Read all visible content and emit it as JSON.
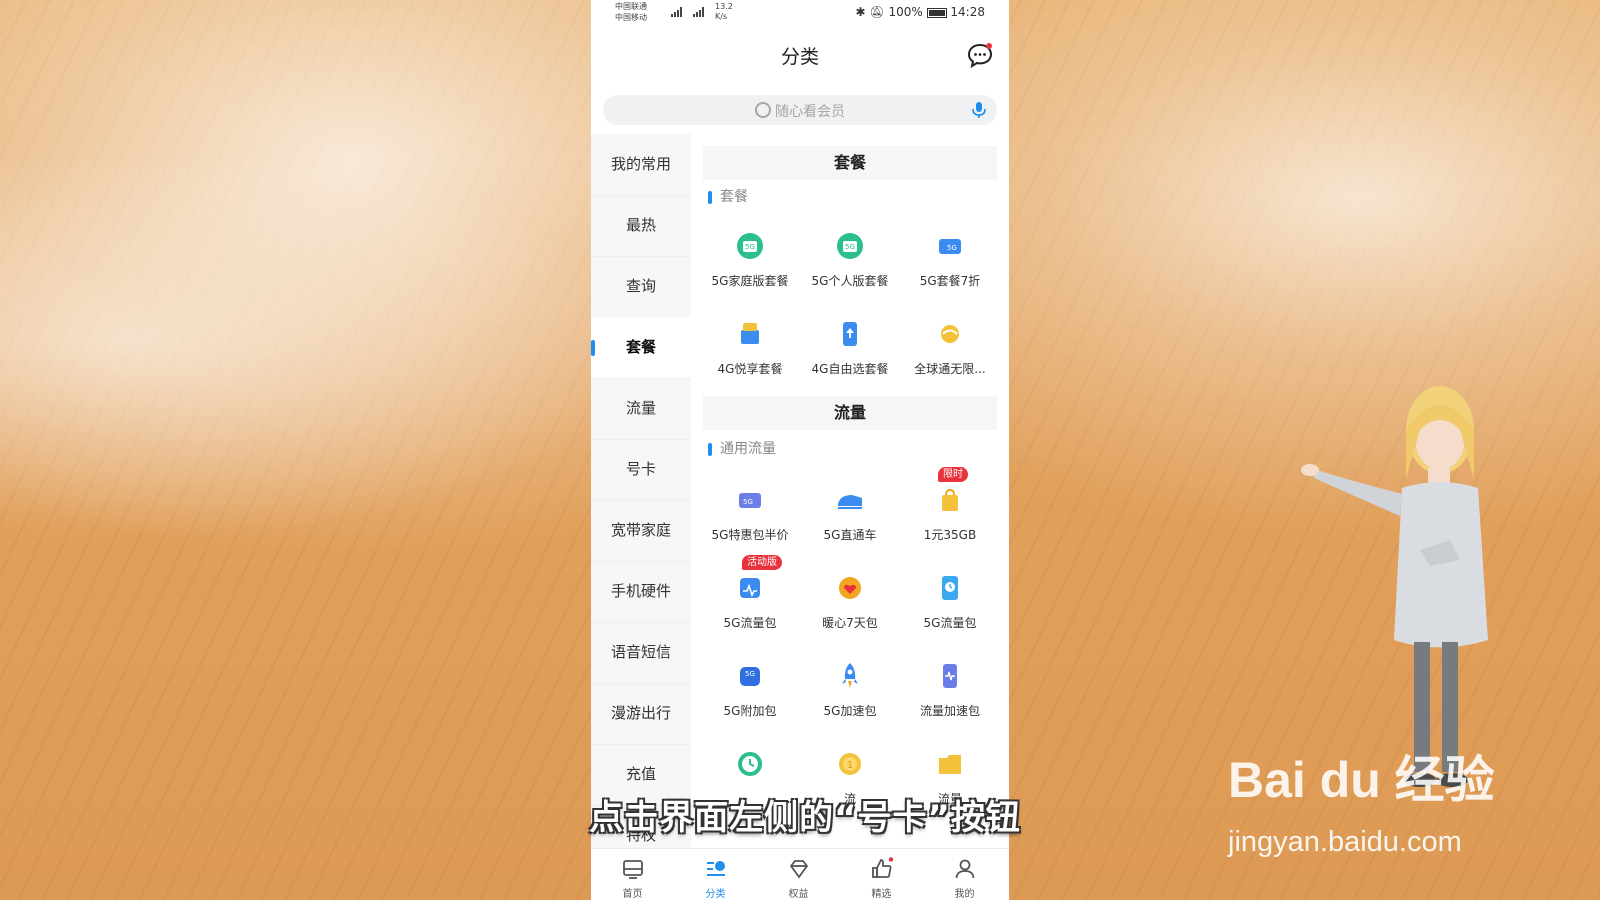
{
  "status_bar": {
    "carrier1": "中国联通",
    "carrier2": "中国移动",
    "speed": "13.2",
    "speed_unit": "K/s",
    "battery": "100%",
    "time": "14:28"
  },
  "header": {
    "title": "分类",
    "message_icon": "chat-bubble-icon"
  },
  "search": {
    "placeholder": "随心看会员"
  },
  "sidebar": {
    "items": [
      {
        "label": "我的常用"
      },
      {
        "label": "最热"
      },
      {
        "label": "查询"
      },
      {
        "label": "套餐",
        "active": true
      },
      {
        "label": "流量"
      },
      {
        "label": "号卡"
      },
      {
        "label": "宽带家庭"
      },
      {
        "label": "手机硬件"
      },
      {
        "label": "语音短信"
      },
      {
        "label": "漫游出行"
      },
      {
        "label": "充值"
      },
      {
        "label": "特权"
      }
    ]
  },
  "sections": [
    {
      "title": "套餐",
      "subtitle": "套餐",
      "items": [
        {
          "label": "5G家庭版套餐"
        },
        {
          "label": "5G个人版套餐"
        },
        {
          "label": "5G套餐7折"
        },
        {
          "label": "4G悦享套餐"
        },
        {
          "label": "4G自由选套餐"
        },
        {
          "label": "全球通无限..."
        }
      ]
    },
    {
      "title": "流量",
      "subtitle": "通用流量",
      "items": [
        {
          "label": "5G特惠包半价"
        },
        {
          "label": "5G直通车"
        },
        {
          "label": "1元35GB",
          "badge": "限时"
        },
        {
          "label": "5G流量包",
          "badge": "活动版"
        },
        {
          "label": "暖心7天包"
        },
        {
          "label": "5G流量包"
        },
        {
          "label": "5G附加包"
        },
        {
          "label": "5G加速包"
        },
        {
          "label": "流量加速包"
        },
        {
          "label": ""
        },
        {
          "label": "流"
        },
        {
          "label": "流量"
        }
      ]
    }
  ],
  "bottom_nav": {
    "items": [
      {
        "label": "首页",
        "icon": "home-icon"
      },
      {
        "label": "分类",
        "icon": "category-icon",
        "active": true
      },
      {
        "label": "权益",
        "icon": "diamond-icon"
      },
      {
        "label": "精选",
        "icon": "thumbs-up-icon"
      },
      {
        "label": "我的",
        "icon": "user-icon"
      }
    ]
  },
  "caption": "点击界面左侧的“号卡”按钮",
  "watermark": {
    "brand": "Bai du 经验",
    "url": "jingyan.baidu.com"
  },
  "colors": {
    "accent": "#1f8ef1",
    "badge": "#e8323c",
    "icon_green": "#2bbf8e",
    "icon_orange": "#f4a623"
  }
}
